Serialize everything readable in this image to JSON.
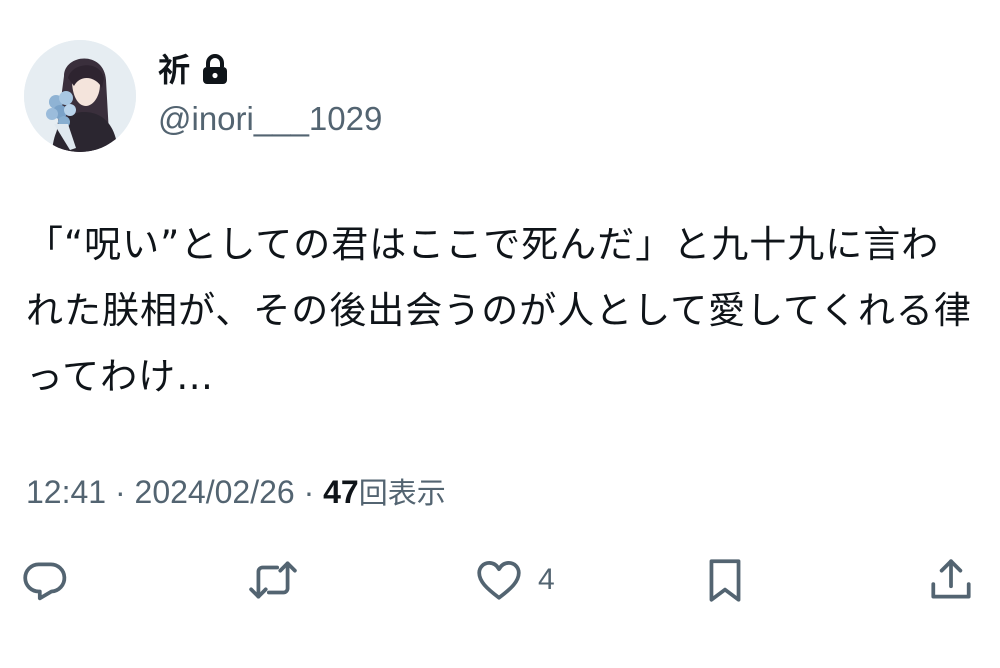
{
  "user": {
    "display_name": "祈",
    "handle": "@inori___1029",
    "protected_icon": "lock-icon",
    "avatar": "avatar-illustration"
  },
  "tweet": {
    "text": "「“呪い”としての君はここで死んだ」と九十九に言われた朕相が、その後出会うのが人として愛してくれる律ってわけ…"
  },
  "meta": {
    "time": "12:41",
    "separator": "·",
    "date": "2024/02/26",
    "views_count": "47",
    "views_label": "回表示"
  },
  "actions": {
    "reply": {
      "icon": "reply-bubble-icon",
      "count": ""
    },
    "retweet": {
      "icon": "retweet-icon",
      "count": ""
    },
    "like": {
      "icon": "heart-icon",
      "count": "4"
    },
    "bookmark": {
      "icon": "bookmark-icon",
      "count": ""
    },
    "share": {
      "icon": "share-icon",
      "count": ""
    }
  },
  "colors": {
    "text_primary": "#0f1419",
    "text_secondary": "#536471",
    "background": "#ffffff"
  }
}
